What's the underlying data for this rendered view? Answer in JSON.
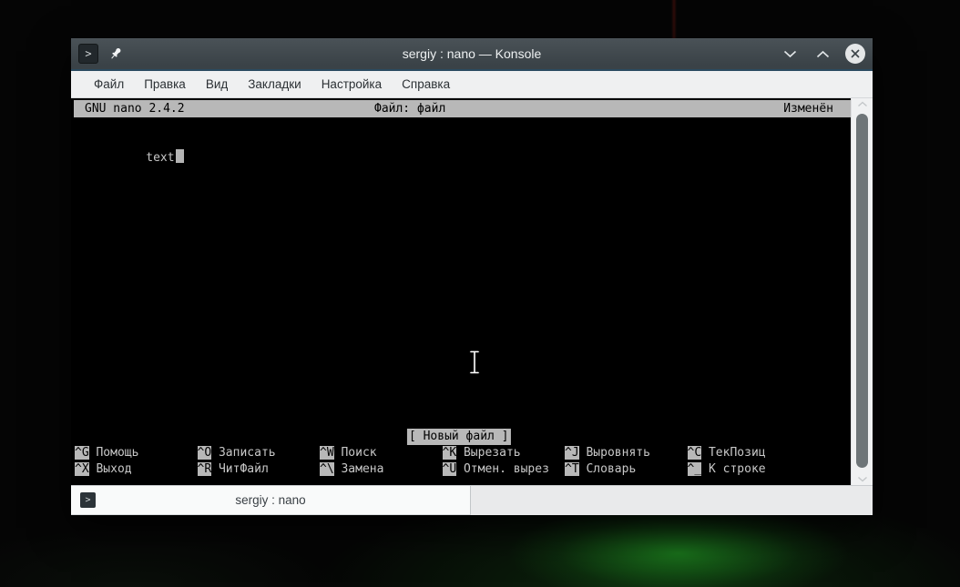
{
  "window": {
    "title": "sergiy : nano — Konsole",
    "app_icon_glyph": ">",
    "colors": {
      "titlebar": "#3a4247",
      "titlebar_accent_line": "#2a4a60",
      "menubar_bg": "#eff0f1",
      "terminal_bg": "#000000",
      "terminal_fg": "#c8c8c8",
      "nano_inverse_bg": "#b8b8b8",
      "desktop_glow_green": "#1c801e"
    }
  },
  "menu": {
    "items": [
      "Файл",
      "Правка",
      "Вид",
      "Закладки",
      "Настройка",
      "Справка"
    ]
  },
  "nano": {
    "header": {
      "version": "GNU nano 2.4.2",
      "file": "Файл: файл",
      "modified": "Изменён"
    },
    "buffer_text": "text",
    "status": "[ Новый файл ]",
    "shortcuts": [
      {
        "key": "^G",
        "label": "Помощь"
      },
      {
        "key": "^O",
        "label": "Записать"
      },
      {
        "key": "^W",
        "label": "Поиск"
      },
      {
        "key": "^K",
        "label": "Вырезать"
      },
      {
        "key": "^J",
        "label": "Выровнять"
      },
      {
        "key": "^C",
        "label": "ТекПозиц"
      },
      {
        "key": "^X",
        "label": "Выход"
      },
      {
        "key": "^R",
        "label": "ЧитФайл"
      },
      {
        "key": "^\\",
        "label": "Замена"
      },
      {
        "key": "^U",
        "label": "Отмен. вырез"
      },
      {
        "key": "^T",
        "label": "Словарь"
      },
      {
        "key": "^_",
        "label": "К строке"
      }
    ]
  },
  "tabbar": {
    "active_tab": "sergiy : nano",
    "tab_icon_glyph": ">"
  }
}
